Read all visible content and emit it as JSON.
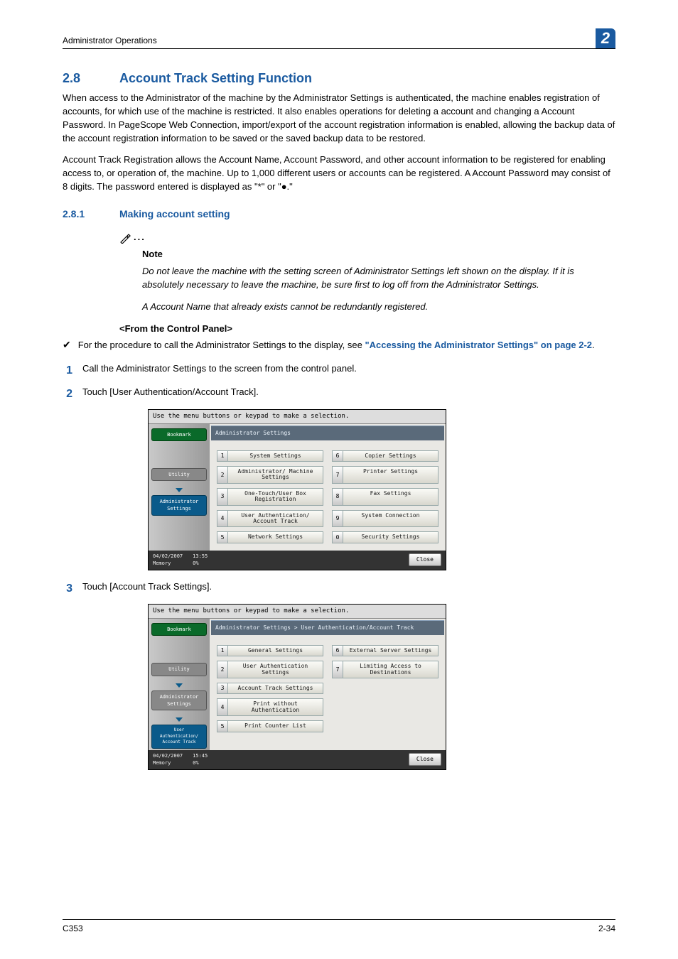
{
  "header": {
    "running": "Administrator Operations",
    "badge": "2"
  },
  "section": {
    "num": "2.8",
    "title": "Account Track Setting Function"
  },
  "para1": "When access to the Administrator of the machine by the Administrator Settings is authenticated, the machine enables registration of accounts, for which use of the machine is restricted. It also enables operations for deleting a account and changing a Account Password. In PageScope Web Connection, import/export of the account registration information is enabled, allowing the backup data of the account registration information to be saved or the saved backup data to be restored.",
  "para2": "Account Track Registration allows the Account Name, Account Password, and other account information to be registered for enabling access to, or operation of, the machine. Up to 1,000 different users or accounts can be registered. A Account Password may consist of 8 digits. The password entered is displayed as \"*\" or \"●.\"",
  "sub": {
    "num": "2.8.1",
    "title": "Making account setting"
  },
  "note": {
    "label": "Note",
    "body1": "Do not leave the machine with the setting screen of Administrator Settings left shown on the display. If it is absolutely necessary to leave the machine, be sure first to log off from the Administrator Settings.",
    "body2": "A Account Name that already exists cannot be redundantly registered."
  },
  "panel_sub": "<From the Control Panel>",
  "bullet": {
    "lead": "For the procedure to call the Administrator Settings to the display, see ",
    "link": "\"Accessing the Administrator Settings\" on page 2-2",
    "tail": "."
  },
  "steps": {
    "s1": {
      "n": "1",
      "t": "Call the Administrator Settings to the screen from the control panel."
    },
    "s2": {
      "n": "2",
      "t": "Touch [User Authentication/Account Track]."
    },
    "s3": {
      "n": "3",
      "t": "Touch [Account Track Settings]."
    }
  },
  "screen_common": {
    "instruction": "Use the menu buttons or keypad to make a selection.",
    "bookmark": "Bookmark",
    "utility": "Utility",
    "admin": "Administrator Settings",
    "user_auth": "User Authentication/ Account Track",
    "close": "Close",
    "memory": "Memory",
    "pct": "0%"
  },
  "screen1": {
    "crumb": "Administrator Settings",
    "opts_left": [
      {
        "n": "1",
        "l": "System Settings"
      },
      {
        "n": "2",
        "l": "Administrator/ Machine Settings"
      },
      {
        "n": "3",
        "l": "One-Touch/User Box Registration"
      },
      {
        "n": "4",
        "l": "User Authentication/ Account Track"
      },
      {
        "n": "5",
        "l": "Network Settings"
      }
    ],
    "opts_right": [
      {
        "n": "6",
        "l": "Copier Settings"
      },
      {
        "n": "7",
        "l": "Printer Settings"
      },
      {
        "n": "8",
        "l": "Fax Settings"
      },
      {
        "n": "9",
        "l": "System Connection"
      },
      {
        "n": "0",
        "l": "Security Settings"
      }
    ],
    "date": "04/02/2007",
    "time": "13:55"
  },
  "screen2": {
    "crumb": "Administrator Settings > User Authentication/Account Track",
    "opts_left": [
      {
        "n": "1",
        "l": "General Settings"
      },
      {
        "n": "2",
        "l": "User Authentication Settings"
      },
      {
        "n": "3",
        "l": "Account Track Settings"
      },
      {
        "n": "4",
        "l": "Print without Authentication"
      },
      {
        "n": "5",
        "l": "Print Counter List"
      }
    ],
    "opts_right": [
      {
        "n": "6",
        "l": "External Server Settings"
      },
      {
        "n": "7",
        "l": "Limiting Access to Destinations"
      }
    ],
    "date": "04/02/2007",
    "time": "15:45"
  },
  "footer": {
    "left": "C353",
    "right": "2-34"
  }
}
